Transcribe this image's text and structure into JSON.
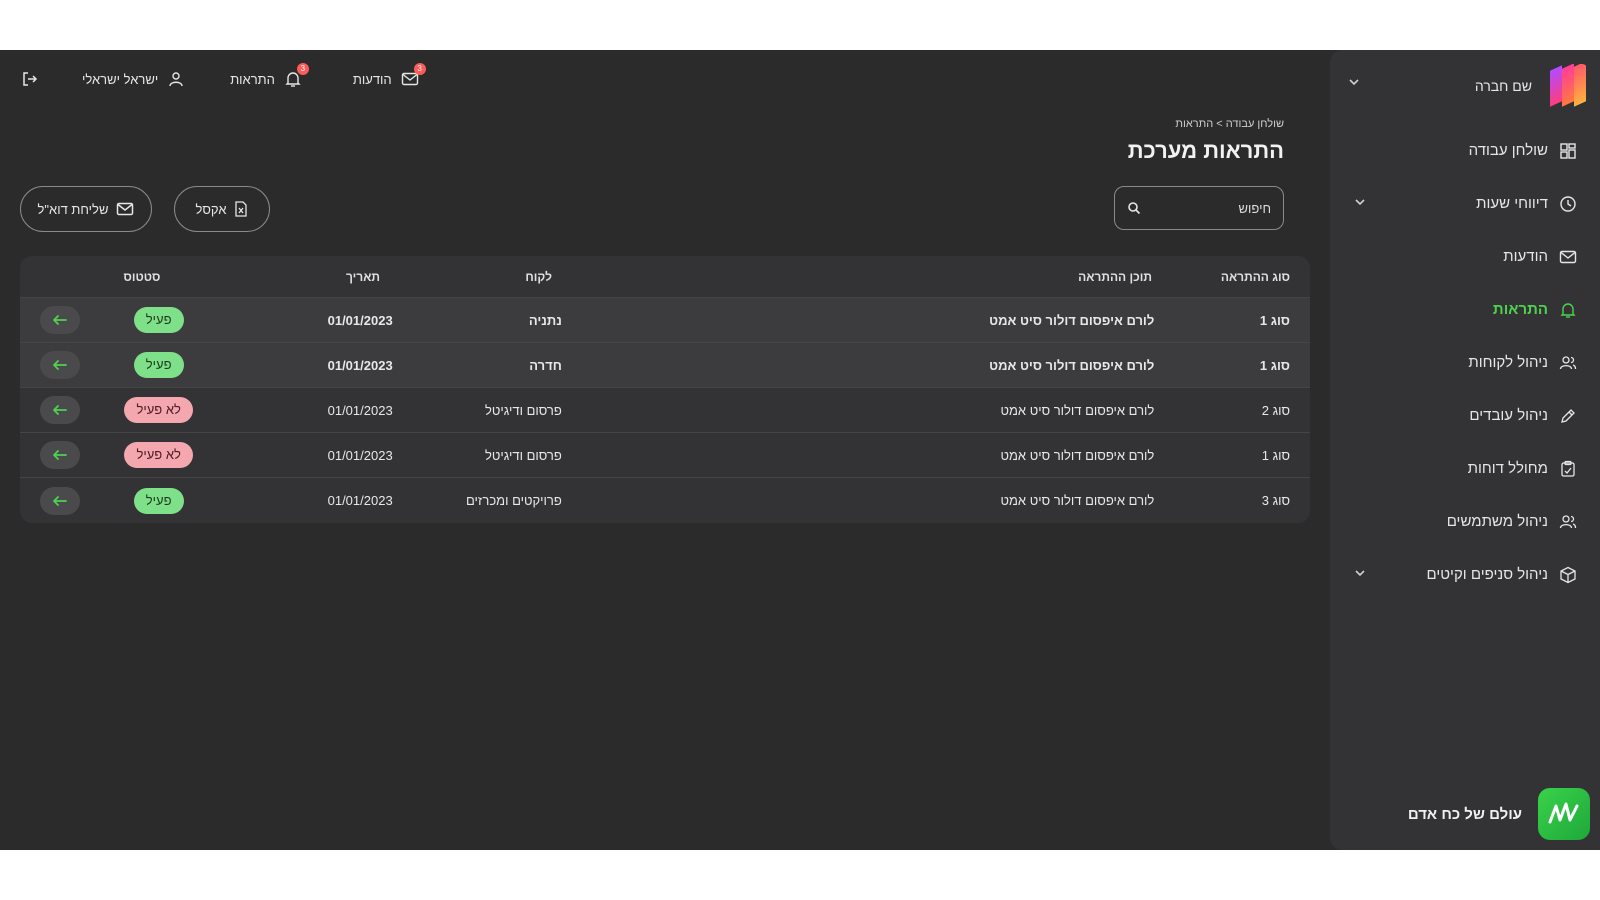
{
  "sidebar": {
    "brand_name": "שם חברה",
    "items": [
      {
        "label": "שולחן עבודה",
        "icon": "dashboard-icon",
        "chevron": false,
        "active": false
      },
      {
        "label": "דיווחי שעות",
        "icon": "clock-icon",
        "chevron": true,
        "active": false
      },
      {
        "label": "הודעות",
        "icon": "mail-icon",
        "chevron": false,
        "active": false
      },
      {
        "label": "התראות",
        "icon": "bell-icon",
        "chevron": false,
        "active": true
      },
      {
        "label": "ניהול לקוחות",
        "icon": "users-icon",
        "chevron": false,
        "active": false
      },
      {
        "label": "ניהול עובדים",
        "icon": "pen-icon",
        "chevron": false,
        "active": false
      },
      {
        "label": "מחולל דוחות",
        "icon": "clipboard-icon",
        "chevron": false,
        "active": false
      },
      {
        "label": "ניהול משתמשים",
        "icon": "users-icon",
        "chevron": false,
        "active": false
      },
      {
        "label": "ניהול סניפים וקיטים",
        "icon": "box-icon",
        "chevron": true,
        "active": false
      }
    ],
    "footer_brand": "עולם של כח אדם"
  },
  "topbar": {
    "messages_label": "הודעות",
    "messages_count": "3",
    "alerts_label": "התראות",
    "alerts_count": "3",
    "user_name": "ישראל ישראלי"
  },
  "header": {
    "breadcrumb": "שולחן עבודה > התראות",
    "title": "התראות מערכת"
  },
  "search": {
    "placeholder": "חיפוש"
  },
  "actions": {
    "email_label": "שליחת דוא\"ל",
    "excel_label": "אקסל"
  },
  "table": {
    "headers": {
      "type": "סוג ההתראה",
      "content": "תוכן ההתראה",
      "client": "לקוח",
      "date": "תאריך",
      "status": "סטטוס"
    },
    "rows": [
      {
        "type": "סוג 1",
        "content": "לורם איפסום דולור סיט אמט",
        "client": "נתניה",
        "date": "01/01/2023",
        "status": "פעיל",
        "status_kind": "active",
        "bold": true,
        "highlight": true
      },
      {
        "type": "סוג 1",
        "content": "לורם איפסום דולור סיט אמט",
        "client": "חדרה",
        "date": "01/01/2023",
        "status": "פעיל",
        "status_kind": "active",
        "bold": true,
        "highlight": true
      },
      {
        "type": "סוג 2",
        "content": "לורם איפסום דולור סיט אמט",
        "client": "פרסום ודיגיטל",
        "date": "01/01/2023",
        "status": "לא פעיל",
        "status_kind": "inactive",
        "bold": false,
        "highlight": false
      },
      {
        "type": "סוג 1",
        "content": "לורם איפסום דולור סיט אמט",
        "client": "פרסום ודיגיטל",
        "date": "01/01/2023",
        "status": "לא פעיל",
        "status_kind": "inactive",
        "bold": false,
        "highlight": false
      },
      {
        "type": "סוג 3",
        "content": "לורם איפסום דולור סיט אמט",
        "client": "פרויקטים ומכרזים",
        "date": "01/01/2023",
        "status": "פעיל",
        "status_kind": "active",
        "bold": false,
        "highlight": false
      }
    ]
  },
  "colors": {
    "accent_green": "#4fd14f",
    "active_pill": "#7fe08a",
    "inactive_pill": "#f4a7ae",
    "badge_red": "#ff5a5a"
  }
}
